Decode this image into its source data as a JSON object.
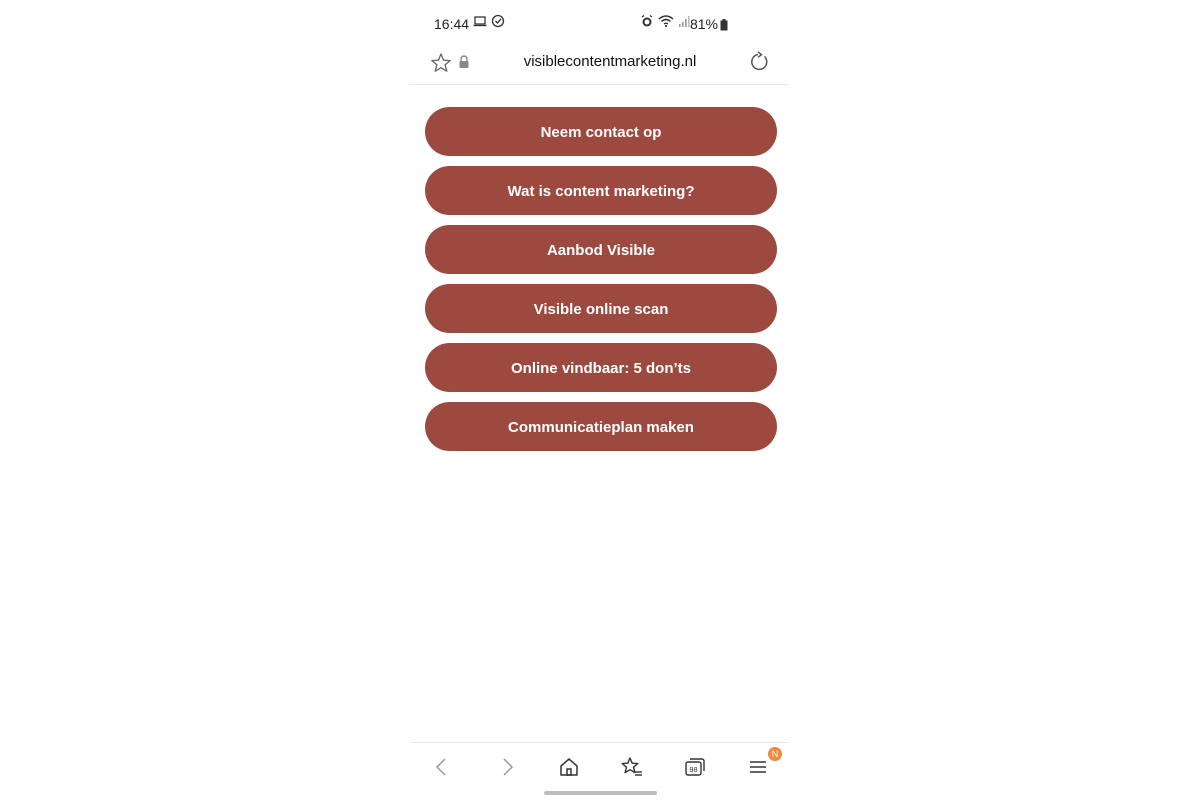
{
  "status_bar": {
    "time": "16:44",
    "battery": "81%",
    "icons": [
      "laptop-icon",
      "check-circle-icon",
      "alarm-icon",
      "wifi-icon",
      "signal-icon",
      "battery-icon"
    ]
  },
  "address_bar": {
    "url": "visiblecontentmarketing.nl",
    "icons": [
      "star-icon",
      "lock-icon",
      "reload-icon"
    ]
  },
  "menu": {
    "items": [
      {
        "label": "Neem contact op"
      },
      {
        "label": "Wat is content marketing?"
      },
      {
        "label": "Aanbod Visible"
      },
      {
        "label": "Visible online scan"
      },
      {
        "label": "Online vindbaar: 5 don’ts"
      },
      {
        "label": "Communicatieplan maken"
      }
    ],
    "button_color": "#9c4a40"
  },
  "bottom_nav": {
    "tabs_count": "98",
    "menu_badge": "N",
    "icons": [
      "back-icon",
      "forward-icon",
      "home-icon",
      "bookmarks-icon",
      "tabs-icon",
      "menu-icon"
    ],
    "badge_color": "#f08a3c"
  }
}
